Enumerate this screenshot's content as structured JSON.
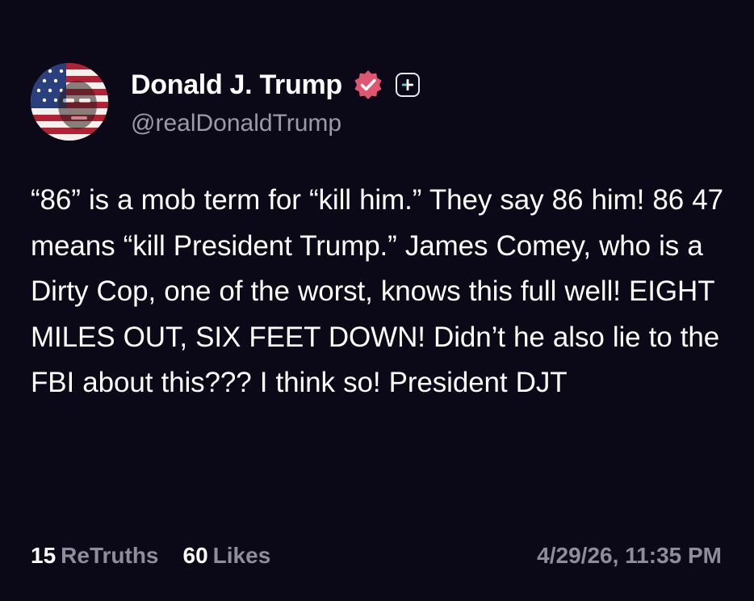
{
  "author": {
    "display_name": "Donald J. Trump",
    "handle": "@realDonaldTrump",
    "verified_icon": "verified-check-icon",
    "plus_icon": "plus-icon"
  },
  "post": {
    "text": "“86” is a mob term for “kill him.” They say 86 him! 86 47 means “kill President Trump.” James Comey, who is a Dirty Cop, one of the worst, knows this full well! EIGHT MILES OUT, SIX FEET DOWN! Didn’t he also lie to the FBI about this??? I think so! President DJT"
  },
  "stats": {
    "retruths_count": "15",
    "retruths_label": "ReTruths",
    "likes_count": "60",
    "likes_label": "Likes"
  },
  "timestamp": "4/29/26, 11:35 PM",
  "colors": {
    "background": "#0b0817",
    "text": "#ffffff",
    "secondary_text": "#8f8d9c",
    "verified_badge": "#e0556f",
    "plus_accent": "#5ad6c7"
  }
}
